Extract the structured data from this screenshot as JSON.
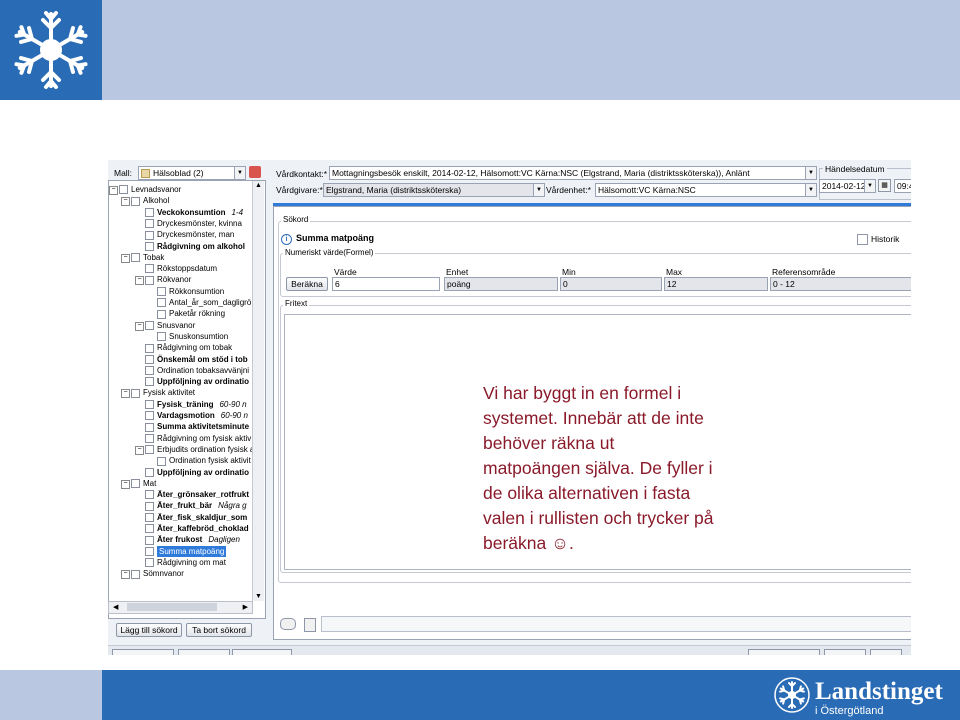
{
  "slide": {
    "overlay_lines": [
      "Vi har byggt in en formel i",
      "systemet. Innebär att de inte",
      "behöver räkna ut",
      "matpoängen själva. De fyller i",
      "de olika alternativen i fasta",
      "valen i rullisten och trycker på",
      "beräkna ☺."
    ],
    "brand_name": "Landstinget",
    "brand_sub": "i Östergötland",
    "colors": {
      "band_light": "#b9c7e1",
      "band_dark": "#2a6bb5",
      "overlay_text": "#8a1a2a"
    }
  },
  "toolbar": {
    "mall_label": "Mall:",
    "mall_value": "Hälsoblad (2)",
    "vardkontakt_label": "Vårdkontakt:*",
    "vardkontakt_value": "Mottagningsbesök enskilt, 2014-02-12, Hälsomott:VC Kärna:NSC (Elgstrand, Maria (distriktssköterska)), Anlänt",
    "vardgivare_label": "Vårdgivare:*",
    "vardgivare_value": "Elgstrand, Maria (distriktssköterska)",
    "vardenhet_label": "Vårdenhet:*",
    "vardenhet_value": "Hälsomott:VC Kärna:NSC",
    "handelsedatum_label": "Händelsedatum",
    "date_value": "2014-02-12",
    "time_value": "09:4"
  },
  "tree": {
    "items": [
      {
        "label": "Levnadsvanor",
        "level": 0,
        "bold": false
      },
      {
        "label": "Alkohol",
        "level": 1,
        "bold": false
      },
      {
        "label": "Veckokonsumtion",
        "level": 2,
        "bold": true,
        "value": "1-4"
      },
      {
        "label": "Dryckesmönster, kvinna",
        "level": 2,
        "bold": false
      },
      {
        "label": "Dryckesmönster, man",
        "level": 2,
        "bold": false
      },
      {
        "label": "Rådgivning om alkohol",
        "level": 2,
        "bold": true
      },
      {
        "label": "Tobak",
        "level": 1,
        "bold": false
      },
      {
        "label": "Rökstoppsdatum",
        "level": 2,
        "bold": false
      },
      {
        "label": "Rökvanor",
        "level": 2,
        "bold": false
      },
      {
        "label": "Rökkonsumtion",
        "level": 3,
        "bold": false
      },
      {
        "label": "Antal_år_som_dagligrö",
        "level": 3,
        "bold": false
      },
      {
        "label": "Paketår rökning",
        "level": 3,
        "bold": false
      },
      {
        "label": "Snusvanor",
        "level": 2,
        "bold": false
      },
      {
        "label": "Snuskonsumtion",
        "level": 3,
        "bold": false
      },
      {
        "label": "Rådgivning om tobak",
        "level": 2,
        "bold": false
      },
      {
        "label": "Önskemål om stöd i tob",
        "level": 2,
        "bold": true
      },
      {
        "label": "Ordination tobaksavvänjni",
        "level": 2,
        "bold": false
      },
      {
        "label": "Uppföljning av ordinatio",
        "level": 2,
        "bold": true
      },
      {
        "label": "Fysisk aktivitet",
        "level": 1,
        "bold": false
      },
      {
        "label": "Fysisk_träning",
        "level": 2,
        "bold": true,
        "value": "60-90 n"
      },
      {
        "label": "Vardagsmotion",
        "level": 2,
        "bold": true,
        "value": "60-90 n"
      },
      {
        "label": "Summa aktivitetsminute",
        "level": 2,
        "bold": true
      },
      {
        "label": "Rådgivning om fysisk aktiv",
        "level": 2,
        "bold": false
      },
      {
        "label": "Erbjudits ordination fysisk a",
        "level": 2,
        "bold": false
      },
      {
        "label": "Ordination fysisk aktivit",
        "level": 3,
        "bold": false
      },
      {
        "label": "Uppföljning av ordinatio",
        "level": 2,
        "bold": true
      },
      {
        "label": "Mat",
        "level": 1,
        "bold": false
      },
      {
        "label": "Äter_grönsaker_rotfrukt",
        "level": 2,
        "bold": true
      },
      {
        "label": "Äter_frukt_bär",
        "level": 2,
        "bold": true,
        "value": "Några g"
      },
      {
        "label": "Äter_fisk_skaldjur_som",
        "level": 2,
        "bold": true
      },
      {
        "label": "Äter_kaffebröd_choklad",
        "level": 2,
        "bold": true
      },
      {
        "label": "Äter frukost",
        "level": 2,
        "bold": true,
        "value": "Dagligen"
      },
      {
        "label": "Summa matpoäng",
        "level": 2,
        "bold": false,
        "selected": true
      },
      {
        "label": "Rådgivning om mat",
        "level": 2,
        "bold": false
      },
      {
        "label": "Sömnvanor",
        "level": 1,
        "bold": false
      }
    ]
  },
  "left_buttons": {
    "add": "Lägg till sökord",
    "remove": "Ta bort sökord"
  },
  "sokord": {
    "group_label": "Sökord",
    "title": "Summa matpoäng",
    "historik_label": "Historik",
    "numeric_group_label": "Numeriskt värde(Formel)",
    "columns": [
      "Värde",
      "Enhet",
      "Min",
      "Max",
      "Referensområde"
    ],
    "berakna_label": "Beräkna",
    "value": "6",
    "unit": "poäng",
    "min": "0",
    "max": "12",
    "reference": "0 - 12",
    "fritext_label": "Fritext"
  }
}
